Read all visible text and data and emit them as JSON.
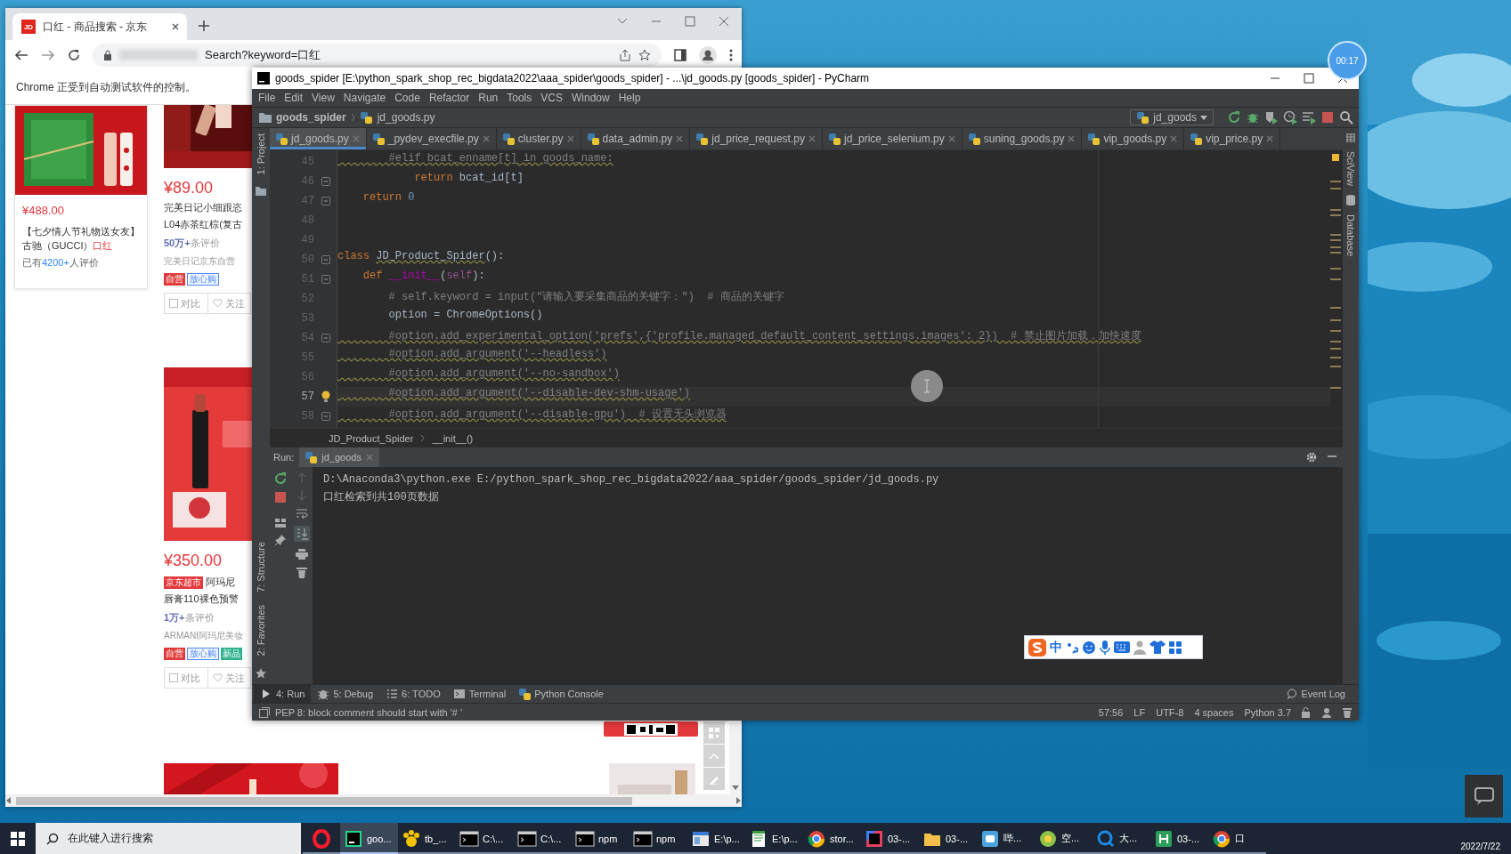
{
  "browser": {
    "tab": {
      "favicon": "JD",
      "title": "口红 - 商品搜索 - 京东"
    },
    "address": "Search?keyword=口红",
    "infobar": "Chrome 正受到自动测试软件的控制。",
    "featured": {
      "price": "¥488.00",
      "title": "【七夕情人节礼物送女友】古驰（GUCCI）",
      "keyword": "口红",
      "reviews_prefix": "已有",
      "reviews_count": "4200+",
      "reviews_suffix": "人评价"
    },
    "products": [
      {
        "price": "¥89.00",
        "title_lines": [
          "完美日记小细跟恣",
          "L04赤茶红棕(复古"
        ],
        "reviews_count": "50万+",
        "reviews_suffix": "条评价",
        "shop": "完美日记京东自营",
        "tags": [
          {
            "text": "自营",
            "kind": "self"
          },
          {
            "text": "放心购",
            "kind": "trust"
          }
        ],
        "compare": "对比",
        "checked": false,
        "follow": "关注"
      },
      {
        "price": "¥350.00",
        "badge": "京东超市",
        "title_lines": [
          "阿玛尼",
          "唇膏110裸色预警"
        ],
        "reviews_count": "1万+",
        "reviews_suffix": "条评价",
        "shop": "ARMANI阿玛尼美妆",
        "tags": [
          {
            "text": "自营",
            "kind": "self"
          },
          {
            "text": "放心购",
            "kind": "trust"
          },
          {
            "text": "新品",
            "kind": "new"
          }
        ],
        "compare": "对比",
        "checked": false,
        "follow": "关注"
      }
    ]
  },
  "ide": {
    "title": "goods_spider [E:\\python_spark_shop_rec_bigdata2022\\aaa_spider\\goods_spider] - ...\\jd_goods.py [goods_spider] - PyCharm",
    "menu": [
      "File",
      "Edit",
      "View",
      "Navigate",
      "Code",
      "Refactor",
      "Run",
      "Tools",
      "VCS",
      "Window",
      "Help"
    ],
    "nav": {
      "project": "goods_spider",
      "file": "jd_goods.py"
    },
    "run_config": "jd_goods",
    "tabs": [
      {
        "label": "jd_goods.py",
        "selected": true
      },
      {
        "label": "_pydev_execfile.py",
        "selected": false
      },
      {
        "label": "cluster.py",
        "selected": false
      },
      {
        "label": "data_admin.py",
        "selected": false
      },
      {
        "label": "jd_price_request.py",
        "selected": false
      },
      {
        "label": "jd_price_selenium.py",
        "selected": false
      },
      {
        "label": "suning_goods.py",
        "selected": false
      },
      {
        "label": "vip_goods.py",
        "selected": false
      },
      {
        "label": "vip_price.py",
        "selected": false
      }
    ],
    "left_tools_top": [
      "1: Project"
    ],
    "left_tools_bottom": [
      "7: Structure",
      "2: Favorites"
    ],
    "right_tools": [
      "SciView",
      "Database"
    ],
    "code": [
      {
        "number": "45",
        "current": false,
        "fold": false,
        "bulb": false,
        "tokens": [
          {
            "kind": "warncomment",
            "text": "        #elif bcat_enname[t] in goods_name:"
          }
        ]
      },
      {
        "number": "46",
        "current": false,
        "fold": true,
        "bulb": false,
        "tokens": [
          {
            "kind": "keyword",
            "text": "            return"
          },
          {
            "kind": "plain",
            "text": " bcat_id[t]"
          }
        ]
      },
      {
        "number": "47",
        "current": false,
        "fold": true,
        "bulb": false,
        "tokens": [
          {
            "kind": "keyword",
            "text": "    return"
          },
          {
            "kind": "number",
            "text": " 0"
          }
        ]
      },
      {
        "number": "48",
        "current": false,
        "fold": false,
        "bulb": false
      },
      {
        "number": "49",
        "current": false,
        "fold": false,
        "bulb": false
      },
      {
        "number": "50",
        "current": false,
        "fold": true,
        "bulb": false,
        "tokens": [
          {
            "kind": "keyword",
            "text": "class "
          },
          {
            "kind": "warnplain",
            "text": "JD_Product_Spider"
          },
          {
            "kind": "plain",
            "text": "():"
          }
        ]
      },
      {
        "number": "51",
        "current": false,
        "fold": true,
        "bulb": false,
        "tokens": [
          {
            "kind": "keyword",
            "text": "    def "
          },
          {
            "kind": "magic",
            "text": "__init__"
          },
          {
            "kind": "plain",
            "text": "("
          },
          {
            "kind": "self",
            "text": "self"
          },
          {
            "kind": "plain",
            "text": "):"
          }
        ]
      },
      {
        "number": "52",
        "current": false,
        "fold": false,
        "bulb": false,
        "tokens": [
          {
            "kind": "comment",
            "text": "        # self.keyword = input(\"请输入要采集商品的关键字：\")  # 商品的关键字"
          }
        ]
      },
      {
        "number": "53",
        "current": false,
        "fold": false,
        "bulb": false,
        "tokens": [
          {
            "kind": "plain",
            "text": "        option = ChromeOptions()"
          }
        ]
      },
      {
        "number": "54",
        "current": false,
        "fold": true,
        "bulb": false,
        "tokens": [
          {
            "kind": "warncomment",
            "text": "        #option.add_experimental_option('prefs',{'profile.managed_default_content_settings.images': 2})  # 禁止图片加载，加快速度"
          }
        ]
      },
      {
        "number": "55",
        "current": false,
        "fold": false,
        "bulb": false,
        "tokens": [
          {
            "kind": "warncomment",
            "text": "        #option.add_argument('--headless')"
          }
        ]
      },
      {
        "number": "56",
        "current": false,
        "fold": false,
        "bulb": false,
        "tokens": [
          {
            "kind": "warncomment",
            "text": "        #option.add_argument('--no-sandbox')"
          }
        ]
      },
      {
        "number": "57",
        "current": true,
        "fold": false,
        "bulb": true,
        "tokens": [
          {
            "kind": "warncomment",
            "text": "        #option.add_argument('--disable-dev-shm-usage')"
          }
        ]
      },
      {
        "number": "58",
        "current": false,
        "fold": true,
        "bulb": false,
        "tokens": [
          {
            "kind": "warncomment",
            "text": "        #option.add_argument('--disable-gpu')  # 设置无头浏览器"
          }
        ]
      }
    ],
    "breadcrumb": [
      "JD_Product_Spider",
      "__init__()"
    ],
    "run": {
      "label": "Run:",
      "tab": "jd_goods",
      "output": [
        "D:\\Anaconda3\\python.exe E:/python_spark_shop_rec_bigdata2022/aaa_spider/goods_spider/jd_goods.py",
        "口红检索到共100页数据"
      ]
    },
    "tool_tabs": [
      {
        "label": "4: Run",
        "kind": "run",
        "selected": true
      },
      {
        "label": "5: Debug",
        "kind": "debug",
        "selected": false
      },
      {
        "label": "6: TODO",
        "kind": "todo",
        "selected": false
      },
      {
        "label": "Terminal",
        "kind": "terminal",
        "selected": false
      },
      {
        "label": "Python Console",
        "kind": "console",
        "selected": false
      }
    ],
    "event_log": "Event Log",
    "status": {
      "message": "PEP 8: block comment should start with '# '",
      "items": [
        "57:56",
        "LF",
        "UTF-8",
        "4 spaces",
        "Python 3.7"
      ]
    }
  },
  "timer": "00:17",
  "ime": {
    "mode": "中"
  },
  "taskbar": {
    "search_placeholder": "在此键入进行搜索",
    "items": [
      {
        "kind": "opera",
        "selected": false
      },
      {
        "kind": "pycharm",
        "label": "goo...",
        "selected": true
      },
      {
        "kind": "paw",
        "label": "tb_...",
        "selected": false
      },
      {
        "kind": "cmd",
        "label": "C:\\...",
        "selected": false
      },
      {
        "kind": "cmd",
        "label": "C:\\...",
        "selected": false
      },
      {
        "kind": "cmd",
        "label": "npm",
        "selected": false
      },
      {
        "kind": "cmd",
        "label": "npm",
        "selected": false
      },
      {
        "kind": "window",
        "label": "E:\\p...",
        "selected": false
      },
      {
        "kind": "notepad",
        "label": "E:\\p...",
        "selected": false
      },
      {
        "kind": "chrome",
        "label": "stor...",
        "selected": false
      },
      {
        "kind": "ide",
        "label": "03-...",
        "selected": false
      },
      {
        "kind": "folder",
        "label": "03-...",
        "selected": false
      },
      {
        "kind": "bluebox",
        "label": "哔...",
        "selected": false
      },
      {
        "kind": "greenball",
        "label": "空...",
        "selected": false
      },
      {
        "kind": "qblue",
        "label": "大...",
        "selected": false
      },
      {
        "kind": "greentile",
        "label": "03-...",
        "selected": false
      },
      {
        "kind": "chrome",
        "label": "口",
        "selected": false
      }
    ],
    "date": "2022/7/22"
  }
}
